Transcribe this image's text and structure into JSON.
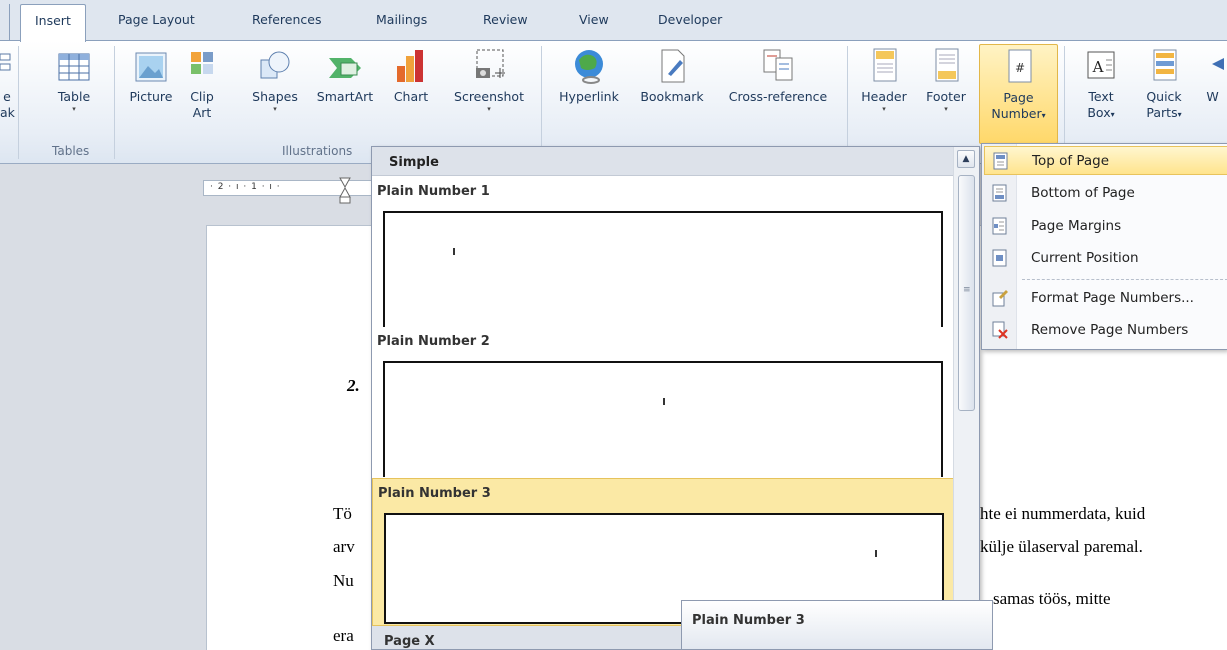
{
  "tabs": {
    "insert": "Insert",
    "page_layout": "Page Layout",
    "references": "References",
    "mailings": "Mailings",
    "review": "Review",
    "view": "View",
    "developer": "Developer"
  },
  "ribbon": {
    "left_partial": {
      "line1": "e",
      "line2": "ak"
    },
    "table": "Table",
    "picture": "Picture",
    "clip_art": {
      "line1": "Clip",
      "line2": "Art"
    },
    "shapes": "Shapes",
    "smartart": "SmartArt",
    "chart": "Chart",
    "screenshot": "Screenshot",
    "hyperlink": "Hyperlink",
    "bookmark": "Bookmark",
    "cross_reference": "Cross-reference",
    "header": "Header",
    "footer": "Footer",
    "page_number": {
      "line1": "Page",
      "line2": "Number"
    },
    "text_box": {
      "line1": "Text",
      "line2": "Box"
    },
    "quick_parts": {
      "line1": "Quick",
      "line2": "Parts"
    },
    "wordart_partial": "W",
    "groups": {
      "tables": "Tables",
      "illustrations": "Illustrations"
    },
    "dropdown_arrow": "▾"
  },
  "ruler": {
    "marks": "· 2 · ı · 1 · ı ·"
  },
  "document": {
    "heading_partial": "2.",
    "line1_left": "Tö",
    "line1_right": "hte ei nummerdata, kuid",
    "line2_left": "arv",
    "line2_right": "külje ülaserval paremal.",
    "line3_left": "Nu",
    "line3_right": "samas töös, mitte",
    "line4_left": "era"
  },
  "gallery": {
    "section_header": "Simple",
    "items": [
      {
        "label": "Plain Number 1"
      },
      {
        "label": "Plain Number 2"
      },
      {
        "label": "Plain Number 3"
      },
      {
        "label": "Page X"
      }
    ]
  },
  "menu": {
    "items": [
      {
        "label": "Top of Page"
      },
      {
        "label": "Bottom of Page"
      },
      {
        "label": "Page Margins"
      },
      {
        "label": "Current Position"
      },
      {
        "label": "Format Page Numbers..."
      },
      {
        "label": "Remove Page Numbers"
      }
    ]
  },
  "tooltip": {
    "title": "Plain Number 3"
  },
  "colors": {
    "selected_fill": "#ffd86a",
    "hover_fill": "#fbe9a5",
    "ribbon_border": "#8ba0bc"
  }
}
